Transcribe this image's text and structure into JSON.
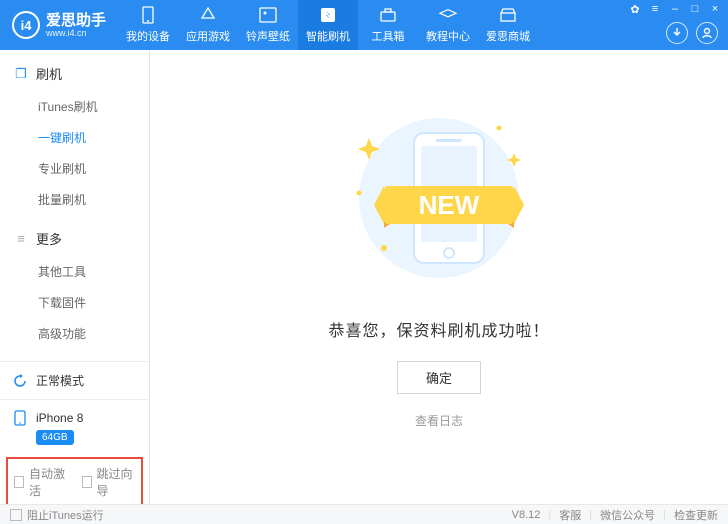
{
  "app": {
    "name": "爱思助手",
    "url": "www.i4.cn",
    "logo_letters": "i4"
  },
  "tabs": [
    {
      "label": "我的设备"
    },
    {
      "label": "应用游戏"
    },
    {
      "label": "铃声壁纸"
    },
    {
      "label": "智能刷机",
      "active": true
    },
    {
      "label": "工具箱"
    },
    {
      "label": "教程中心"
    },
    {
      "label": "爱思商城"
    }
  ],
  "sidebar": {
    "group1": {
      "title": "刷机",
      "items": [
        "iTunes刷机",
        "一键刷机",
        "专业刷机",
        "批量刷机"
      ],
      "active_index": 1
    },
    "group2": {
      "title": "更多",
      "items": [
        "其他工具",
        "下载固件",
        "高级功能"
      ]
    },
    "mode": "正常模式",
    "device": {
      "name": "iPhone 8",
      "storage": "64GB"
    },
    "checks": {
      "a": "自动激活",
      "b": "跳过向导"
    }
  },
  "main": {
    "message": "恭喜您，保资料刷机成功啦！",
    "ok": "确定",
    "log": "查看日志",
    "badge": "NEW"
  },
  "footer": {
    "block_itunes": "阻止iTunes运行",
    "version": "V8.12",
    "support": "客服",
    "wechat": "微信公众号",
    "update": "检查更新"
  }
}
